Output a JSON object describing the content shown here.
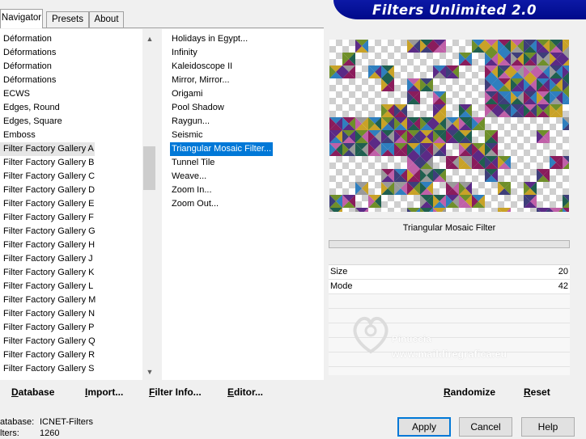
{
  "tabs": [
    {
      "label": "Navigator",
      "active": true
    },
    {
      "label": "Presets",
      "active": false
    },
    {
      "label": "About",
      "active": false
    }
  ],
  "banner": {
    "title": "Filters Unlimited 2.0"
  },
  "categories": {
    "items": [
      "Déformation",
      "Déformations",
      "Déformation",
      "Déformations",
      "ECWS",
      "Edges, Round",
      "Edges, Square",
      "Emboss",
      "Filter Factory Gallery A",
      "Filter Factory Gallery B",
      "Filter Factory Gallery C",
      "Filter Factory Gallery D",
      "Filter Factory Gallery E",
      "Filter Factory Gallery F",
      "Filter Factory Gallery G",
      "Filter Factory Gallery H",
      "Filter Factory Gallery J",
      "Filter Factory Gallery K",
      "Filter Factory Gallery L",
      "Filter Factory Gallery M",
      "Filter Factory Gallery N",
      "Filter Factory Gallery P",
      "Filter Factory Gallery Q",
      "Filter Factory Gallery R",
      "Filter Factory Gallery S"
    ],
    "selected_index": 8
  },
  "filters": {
    "items": [
      "Holidays in Egypt...",
      "Infinity",
      "Kaleidoscope II",
      "Mirror, Mirror...",
      "Origami",
      "Pool Shadow",
      "Raygun...",
      "Seismic",
      "Triangular Mosaic Filter...",
      "Tunnel Tile",
      "Weave...",
      "Zoom In...",
      "Zoom Out..."
    ],
    "selected_index": 8
  },
  "preview": {
    "filter_name": "Triangular Mosaic Filter"
  },
  "params": [
    {
      "name": "Size",
      "value": "20"
    },
    {
      "name": "Mode",
      "value": "42"
    }
  ],
  "watermark": {
    "line1": "Pinuccia",
    "line2": "www.maildiregrafica.eu"
  },
  "toolbar": {
    "database": "Database",
    "import": "Import...",
    "filter_info": "Filter Info...",
    "editor": "Editor...",
    "randomize": "Randomize",
    "reset": "Reset"
  },
  "status": {
    "database_label": "atabase:",
    "database_value": "ICNET-Filters",
    "filters_label": "lters:",
    "filters_value": "1260"
  },
  "buttons": {
    "apply": "Apply",
    "cancel": "Cancel",
    "help": "Help"
  },
  "colors": {
    "banner": "#000a8a",
    "selection": "#0078d7",
    "mosaic_palette": [
      "#5b2a86",
      "#8a1c5c",
      "#6f8f2a",
      "#2f7fbf",
      "#c9a227",
      "#3e3e7a",
      "#1f5f4f",
      "#9a9a9a",
      "#c060a8"
    ]
  }
}
